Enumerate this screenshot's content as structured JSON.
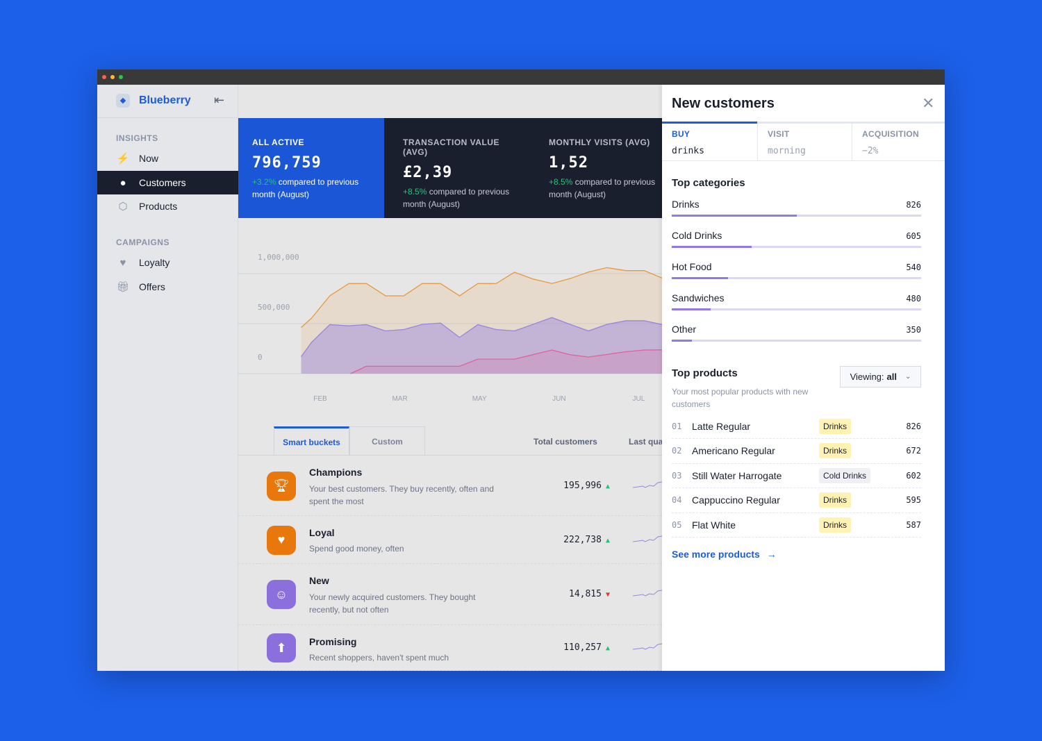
{
  "app": {
    "name": "Blueberry"
  },
  "sidebar": {
    "sections": [
      {
        "label": "INSIGHTS",
        "items": [
          {
            "label": "Now",
            "icon": "bolt-icon"
          },
          {
            "label": "Customers",
            "icon": "user-icon",
            "active": true
          },
          {
            "label": "Products",
            "icon": "box-icon"
          }
        ]
      },
      {
        "label": "CAMPAIGNS",
        "items": [
          {
            "label": "Loyalty",
            "icon": "heart-icon"
          },
          {
            "label": "Offers",
            "icon": "gift-icon"
          }
        ]
      }
    ]
  },
  "stats": [
    {
      "label": "ALL ACTIVE",
      "value": "796,759",
      "change": "+3.2%",
      "compare": "compared to previous month (August)"
    },
    {
      "label": "TRANSACTION VALUE (AVG)",
      "value": "£2,39",
      "change": "+8.5%",
      "compare": "compared to previous month (August)"
    },
    {
      "label": "MONTHLY VISITS (AVG)",
      "value": "1,52",
      "change": "+8.5%",
      "compare": "compared to previous month (August)"
    }
  ],
  "colors": {
    "accent": "#1d5bd8",
    "dark": "#1a1f2e",
    "orange": "#e8780c",
    "purple": "#8b6fdc",
    "pink": "#e0609a",
    "positive": "#24c27a",
    "negative": "#e0392b"
  },
  "chart_data": {
    "type": "area",
    "x_ticks": [
      "FEB",
      "MAR",
      "MAY",
      "JUN",
      "JUL"
    ],
    "y_ticks": [
      "1,000,000",
      "500,000",
      "0"
    ],
    "ylim": [
      0,
      1000000
    ],
    "grid": true,
    "series": [
      {
        "color": "#e8973a",
        "points": [
          [
            -0.24,
            462000
          ],
          [
            -0.11,
            554000
          ],
          [
            0.12,
            778000
          ],
          [
            0.36,
            901000
          ],
          [
            0.58,
            901000
          ],
          [
            0.82,
            778000
          ],
          [
            1.05,
            778000
          ],
          [
            1.28,
            901000
          ],
          [
            1.51,
            901000
          ],
          [
            1.75,
            778000
          ],
          [
            1.98,
            901000
          ],
          [
            2.21,
            901000
          ],
          [
            2.44,
            1014000
          ],
          [
            2.67,
            947000
          ],
          [
            2.91,
            901000
          ],
          [
            3.14,
            951000
          ],
          [
            3.37,
            1016000
          ],
          [
            3.6,
            1060000
          ],
          [
            3.84,
            1030000
          ],
          [
            4.07,
            1030000
          ],
          [
            4.3,
            954000
          ],
          [
            4.36,
            970000
          ]
        ]
      },
      {
        "color": "#9a83e0",
        "points": [
          [
            -0.24,
            169000
          ],
          [
            -0.11,
            312000
          ],
          [
            0.12,
            490000
          ],
          [
            0.36,
            478000
          ],
          [
            0.58,
            490000
          ],
          [
            0.82,
            427000
          ],
          [
            1.05,
            441000
          ],
          [
            1.28,
            492000
          ],
          [
            1.51,
            506000
          ],
          [
            1.75,
            363000
          ],
          [
            1.98,
            490000
          ],
          [
            2.21,
            441000
          ],
          [
            2.44,
            427000
          ],
          [
            2.67,
            492000
          ],
          [
            2.91,
            561000
          ],
          [
            3.14,
            492000
          ],
          [
            3.37,
            427000
          ],
          [
            3.6,
            492000
          ],
          [
            3.84,
            529000
          ],
          [
            4.07,
            529000
          ],
          [
            4.3,
            490000
          ],
          [
            4.36,
            490000
          ]
        ]
      },
      {
        "color": "#e0609a",
        "points": [
          [
            0.38,
            0
          ],
          [
            0.58,
            74000
          ],
          [
            1.75,
            74000
          ],
          [
            1.98,
            145000
          ],
          [
            2.44,
            145000
          ],
          [
            2.91,
            236000
          ],
          [
            3.14,
            189000
          ],
          [
            3.37,
            166000
          ],
          [
            3.6,
            192000
          ],
          [
            3.84,
            219000
          ],
          [
            4.07,
            236000
          ],
          [
            4.36,
            238000
          ]
        ]
      }
    ]
  },
  "table": {
    "tabs": [
      {
        "label": "Smart buckets",
        "active": true
      },
      {
        "label": "Custom"
      }
    ],
    "columns": [
      "Total customers",
      "Last qua"
    ],
    "rows": [
      {
        "name": "Champions",
        "desc": "Your best customers. They buy recently, often and spent the most",
        "total": "195,996",
        "trend": "up",
        "icon": "trophy-icon"
      },
      {
        "name": "Loyal",
        "desc": "Spend good money, often",
        "total": "222,738",
        "trend": "up",
        "icon": "heart-icon"
      },
      {
        "name": "New",
        "desc": "Your newly acquired customers. They bought recently, but not often",
        "total": "14,815",
        "trend": "down",
        "icon": "baby-icon"
      },
      {
        "name": "Promising",
        "desc": "Recent shoppers, haven't spent much",
        "total": "110,257",
        "trend": "up",
        "icon": "arrow-up-icon"
      }
    ]
  },
  "panel": {
    "title": "New customers",
    "tabs": [
      {
        "label": "BUY",
        "value": "drinks",
        "active": true
      },
      {
        "label": "VISIT",
        "value": "morning"
      },
      {
        "label": "ACQUISITION",
        "value": "−2%"
      }
    ],
    "categories_title": "Top categories",
    "categories": [
      {
        "name": "Drinks",
        "count": "826",
        "fill": 0.5
      },
      {
        "name": "Cold Drinks",
        "count": "605",
        "fill": 0.32
      },
      {
        "name": "Hot Food",
        "count": "540",
        "fill": 0.225
      },
      {
        "name": "Sandwiches",
        "count": "480",
        "fill": 0.156
      },
      {
        "name": "Other",
        "count": "350",
        "fill": 0.08
      }
    ],
    "products_title": "Top products",
    "products_subtitle": "Your most popular products with new customers",
    "viewing_prefix": "Viewing:",
    "viewing_value": "all",
    "products": [
      {
        "rank": "01",
        "name": "Latte Regular",
        "tag": "Drinks",
        "count": "826"
      },
      {
        "rank": "02",
        "name": "Americano Regular",
        "tag": "Drinks",
        "count": "672"
      },
      {
        "rank": "03",
        "name": "Still Water Harrogate",
        "tag": "Cold Drinks",
        "count": "602"
      },
      {
        "rank": "04",
        "name": "Cappuccino Regular",
        "tag": "Drinks",
        "count": "595"
      },
      {
        "rank": "05",
        "name": "Flat White",
        "tag": "Drinks",
        "count": "587"
      }
    ],
    "see_more": "See more products"
  }
}
